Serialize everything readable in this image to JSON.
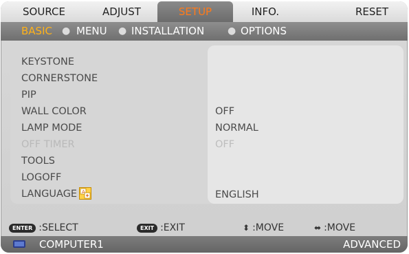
{
  "tabs": [
    {
      "label": "SOURCE"
    },
    {
      "label": "ADJUST"
    },
    {
      "label": "SETUP",
      "active": true
    },
    {
      "label": "INFO."
    },
    {
      "label": "RESET"
    }
  ],
  "subtabs": [
    {
      "label": "BASIC",
      "active": true
    },
    {
      "label": "MENU"
    },
    {
      "label": "INSTALLATION"
    },
    {
      "label": "OPTIONS"
    }
  ],
  "menu": [
    {
      "label": "KEYSTONE",
      "value": ""
    },
    {
      "label": "CORNERSTONE",
      "value": ""
    },
    {
      "label": "PIP",
      "value": ""
    },
    {
      "label": "WALL COLOR",
      "value": "OFF"
    },
    {
      "label": "LAMP MODE",
      "value": "NORMAL"
    },
    {
      "label": "OFF TIMER",
      "value": "OFF",
      "disabled": true
    },
    {
      "label": "TOOLS",
      "value": ""
    },
    {
      "label": "LOGOFF",
      "value": ""
    },
    {
      "label": "LANGUAGE",
      "value": "ENGLISH",
      "icon": "language-icon"
    }
  ],
  "hints": [
    {
      "key": "ENTER",
      "label": ":SELECT"
    },
    {
      "key": "EXIT",
      "label": ":EXIT"
    },
    {
      "key": "up-down-arrows-icon",
      "label": ":MOVE"
    },
    {
      "key": "left-right-arrows-icon",
      "label": ":MOVE"
    }
  ],
  "status": {
    "source_icon": "computer-monitor-icon",
    "source_label": "COMPUTER1",
    "mode": "ADVANCED"
  },
  "colors": {
    "active_tab_text": "#ff7a1a",
    "active_subtab_text": "#ffb21a",
    "disabled_text": "#b9b9b9"
  }
}
